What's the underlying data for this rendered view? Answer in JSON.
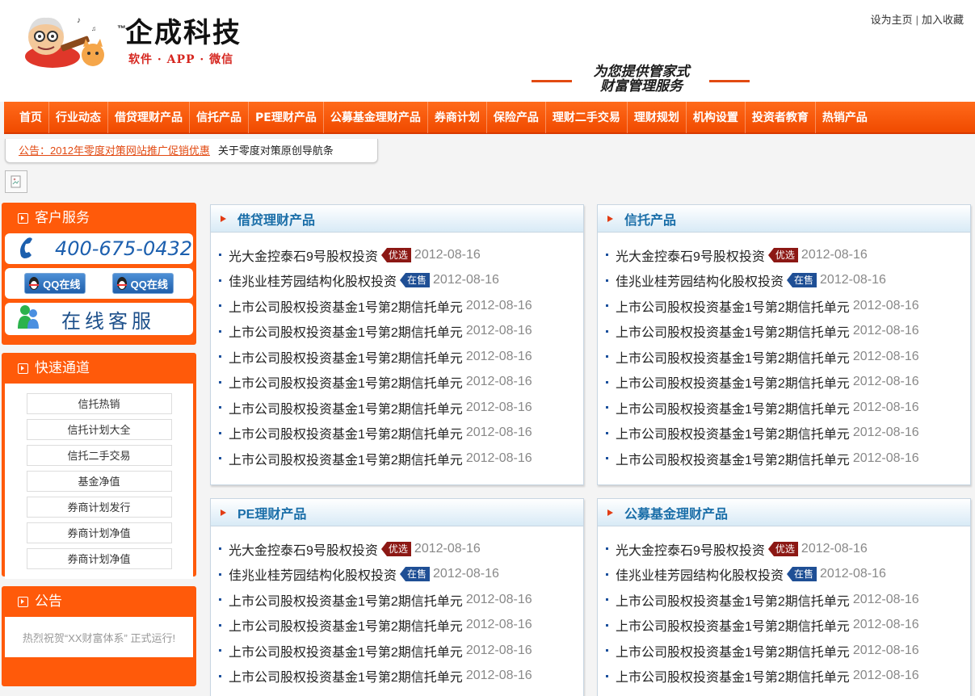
{
  "brand": {
    "name": "企成科技",
    "tagline": "软件 · APP · 微信",
    "tm": "™"
  },
  "toplinks": {
    "home": "设为主页",
    "sep": "|",
    "fav": "加入收藏"
  },
  "slogan": {
    "line1": "为您提供管家式",
    "line2": "财富管理服务"
  },
  "nav": [
    "首页",
    "行业动态",
    "借贷理财产品",
    "信托产品",
    "PE理财产品",
    "公募基金理财产品",
    "券商计划",
    "保险产品",
    "理财二手交易",
    "理财规划",
    "机构设置",
    "投资者教育",
    "热销产品"
  ],
  "notice": {
    "item1": "公告：2012年零度对策网站推广促销优惠",
    "item2": "关于零度对策原创导航条"
  },
  "sidebar": {
    "service": {
      "title": "客户服务",
      "phone": "400-675-0432",
      "qq1": "QQ在线",
      "qq2": "QQ在线",
      "online": "在线客服"
    },
    "quick": {
      "title": "快速通道",
      "items": [
        "信托热销",
        "信托计划大全",
        "信托二手交易",
        "基金净值",
        "券商计划发行",
        "券商计划净值",
        "券商计划净值"
      ]
    },
    "announce": {
      "title": "公告",
      "text": "热烈祝贺“XX财富体系” 正式运行!"
    }
  },
  "panels": [
    {
      "title": "借贷理财产品",
      "rows": [
        {
          "text": "光大金控泰石9号股权投资",
          "tag": "优选",
          "tagcolor": "red",
          "date": "2012-08-16"
        },
        {
          "text": "佳兆业桂芳园结构化股权投资",
          "tag": "在售",
          "tagcolor": "blue",
          "date": "2012-08-16"
        },
        {
          "text": "上市公司股权投资基金1号第2期信托单元",
          "tag": "",
          "date": "2012-08-16"
        },
        {
          "text": "上市公司股权投资基金1号第2期信托单元",
          "tag": "",
          "date": "2012-08-16"
        },
        {
          "text": "上市公司股权投资基金1号第2期信托单元",
          "tag": "",
          "date": "2012-08-16"
        },
        {
          "text": "上市公司股权投资基金1号第2期信托单元",
          "tag": "",
          "date": "2012-08-16"
        },
        {
          "text": "上市公司股权投资基金1号第2期信托单元",
          "tag": "",
          "date": "2012-08-16"
        },
        {
          "text": "上市公司股权投资基金1号第2期信托单元",
          "tag": "",
          "date": "2012-08-16"
        },
        {
          "text": "上市公司股权投资基金1号第2期信托单元",
          "tag": "",
          "date": "2012-08-16"
        }
      ]
    },
    {
      "title": "信托产品",
      "rows": [
        {
          "text": "光大金控泰石9号股权投资",
          "tag": "优选",
          "tagcolor": "red",
          "date": "2012-08-16"
        },
        {
          "text": "佳兆业桂芳园结构化股权投资",
          "tag": "在售",
          "tagcolor": "blue",
          "date": "2012-08-16"
        },
        {
          "text": "上市公司股权投资基金1号第2期信托单元",
          "tag": "",
          "date": "2012-08-16"
        },
        {
          "text": "上市公司股权投资基金1号第2期信托单元",
          "tag": "",
          "date": "2012-08-16"
        },
        {
          "text": "上市公司股权投资基金1号第2期信托单元",
          "tag": "",
          "date": "2012-08-16"
        },
        {
          "text": "上市公司股权投资基金1号第2期信托单元",
          "tag": "",
          "date": "2012-08-16"
        },
        {
          "text": "上市公司股权投资基金1号第2期信托单元",
          "tag": "",
          "date": "2012-08-16"
        },
        {
          "text": "上市公司股权投资基金1号第2期信托单元",
          "tag": "",
          "date": "2012-08-16"
        },
        {
          "text": "上市公司股权投资基金1号第2期信托单元",
          "tag": "",
          "date": "2012-08-16"
        }
      ]
    },
    {
      "title": "PE理财产品",
      "rows": [
        {
          "text": "光大金控泰石9号股权投资",
          "tag": "优选",
          "tagcolor": "red",
          "date": "2012-08-16"
        },
        {
          "text": "佳兆业桂芳园结构化股权投资",
          "tag": "在售",
          "tagcolor": "blue",
          "date": "2012-08-16"
        },
        {
          "text": "上市公司股权投资基金1号第2期信托单元",
          "tag": "",
          "date": "2012-08-16"
        },
        {
          "text": "上市公司股权投资基金1号第2期信托单元",
          "tag": "",
          "date": "2012-08-16"
        },
        {
          "text": "上市公司股权投资基金1号第2期信托单元",
          "tag": "",
          "date": "2012-08-16"
        },
        {
          "text": "上市公司股权投资基金1号第2期信托单元",
          "tag": "",
          "date": "2012-08-16"
        }
      ]
    },
    {
      "title": "公募基金理财产品",
      "rows": [
        {
          "text": "光大金控泰石9号股权投资",
          "tag": "优选",
          "tagcolor": "red",
          "date": "2012-08-16"
        },
        {
          "text": "佳兆业桂芳园结构化股权投资",
          "tag": "在售",
          "tagcolor": "blue",
          "date": "2012-08-16"
        },
        {
          "text": "上市公司股权投资基金1号第2期信托单元",
          "tag": "",
          "date": "2012-08-16"
        },
        {
          "text": "上市公司股权投资基金1号第2期信托单元",
          "tag": "",
          "date": "2012-08-16"
        },
        {
          "text": "上市公司股权投资基金1号第2期信托单元",
          "tag": "",
          "date": "2012-08-16"
        },
        {
          "text": "上市公司股权投资基金1号第2期信托单元",
          "tag": "",
          "date": "2012-08-16"
        }
      ]
    }
  ]
}
